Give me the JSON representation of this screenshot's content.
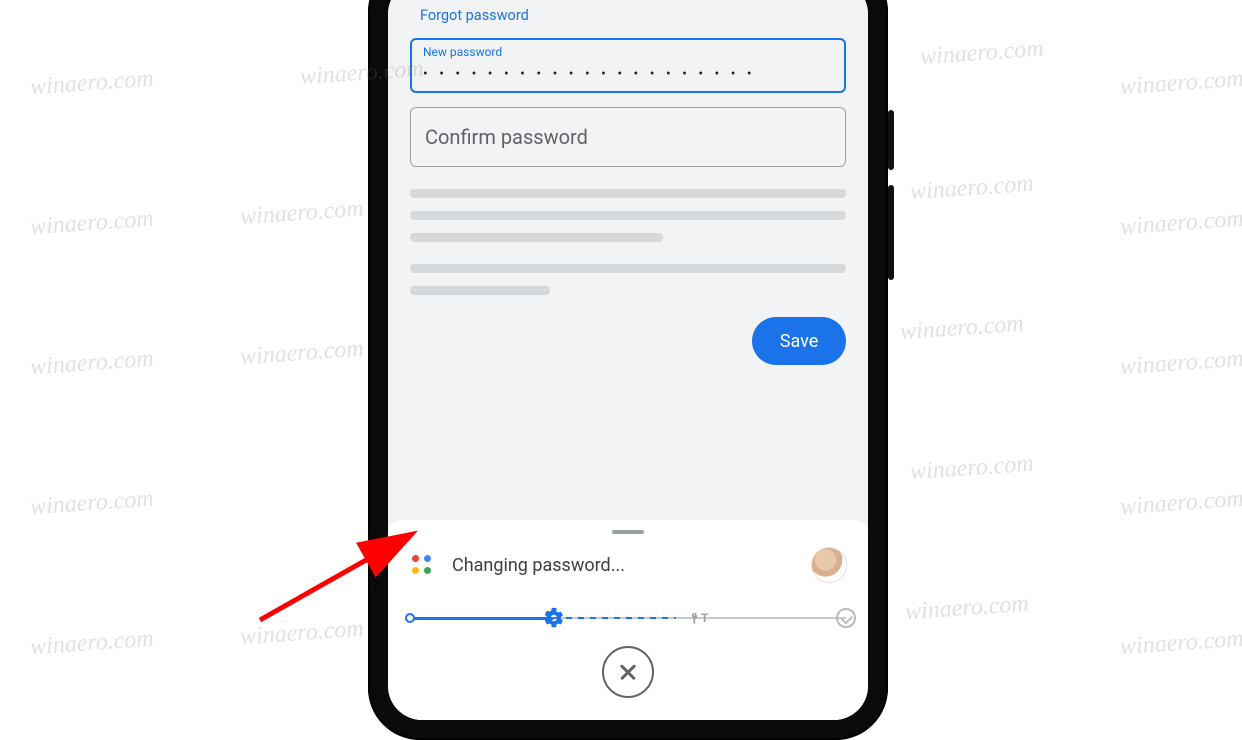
{
  "watermark": "winaero.com",
  "form": {
    "forgot_link": "Forgot password",
    "new_password_label": "New password",
    "new_password_masked": "• • • • • • • • • • • • • • • • • • • • •",
    "confirm_password_label": "Confirm password",
    "save_label": "Save"
  },
  "assistant": {
    "status_text": "Changing password...",
    "steps": [
      "start",
      "settings",
      "credentials",
      "done"
    ],
    "active_step_index": 1
  },
  "icons": {
    "assistant": "google-assistant-icon",
    "gear": "gear-icon",
    "key": "key-icon",
    "check": "check-circle-icon",
    "close": "close-icon"
  },
  "colors": {
    "accent": "#1a73e8",
    "google_red": "#ea4335",
    "google_blue": "#4285f4",
    "google_yellow": "#fbbc04",
    "google_green": "#34a853"
  }
}
